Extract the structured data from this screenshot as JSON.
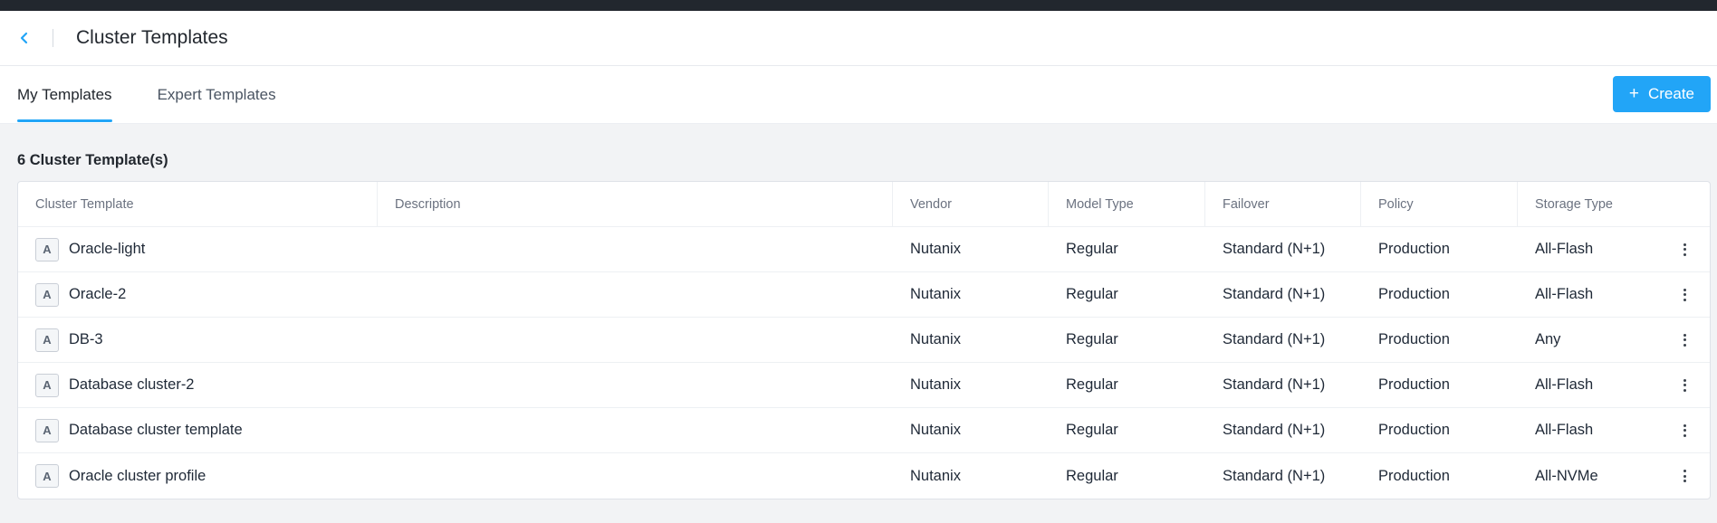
{
  "header": {
    "title": "Cluster Templates"
  },
  "tabs": [
    {
      "label": "My Templates",
      "active": true
    },
    {
      "label": "Expert Templates",
      "active": false
    }
  ],
  "create_button": {
    "label": "Create",
    "icon": "plus-icon"
  },
  "count_label": "6 Cluster Template(s)",
  "table": {
    "columns": [
      "Cluster Template",
      "Description",
      "Vendor",
      "Model Type",
      "Failover",
      "Policy",
      "Storage Type"
    ],
    "rows": [
      {
        "avatar": "A",
        "name": "Oracle-light",
        "description": "",
        "vendor": "Nutanix",
        "model_type": "Regular",
        "failover": "Standard (N+1)",
        "policy": "Production",
        "storage_type": "All-Flash"
      },
      {
        "avatar": "A",
        "name": "Oracle-2",
        "description": "",
        "vendor": "Nutanix",
        "model_type": "Regular",
        "failover": "Standard (N+1)",
        "policy": "Production",
        "storage_type": "All-Flash"
      },
      {
        "avatar": "A",
        "name": "DB-3",
        "description": "",
        "vendor": "Nutanix",
        "model_type": "Regular",
        "failover": "Standard (N+1)",
        "policy": "Production",
        "storage_type": "Any"
      },
      {
        "avatar": "A",
        "name": "Database cluster-2",
        "description": "",
        "vendor": "Nutanix",
        "model_type": "Regular",
        "failover": "Standard (N+1)",
        "policy": "Production",
        "storage_type": "All-Flash"
      },
      {
        "avatar": "A",
        "name": "Database cluster template",
        "description": "",
        "vendor": "Nutanix",
        "model_type": "Regular",
        "failover": "Standard (N+1)",
        "policy": "Production",
        "storage_type": "All-Flash"
      },
      {
        "avatar": "A",
        "name": "Oracle cluster profile",
        "description": "",
        "vendor": "Nutanix",
        "model_type": "Regular",
        "failover": "Standard (N+1)",
        "policy": "Production",
        "storage_type": "All-NVMe"
      }
    ]
  },
  "colors": {
    "accent": "#22a5f7",
    "topbar": "#22272e",
    "page_background": "#f2f3f5"
  }
}
